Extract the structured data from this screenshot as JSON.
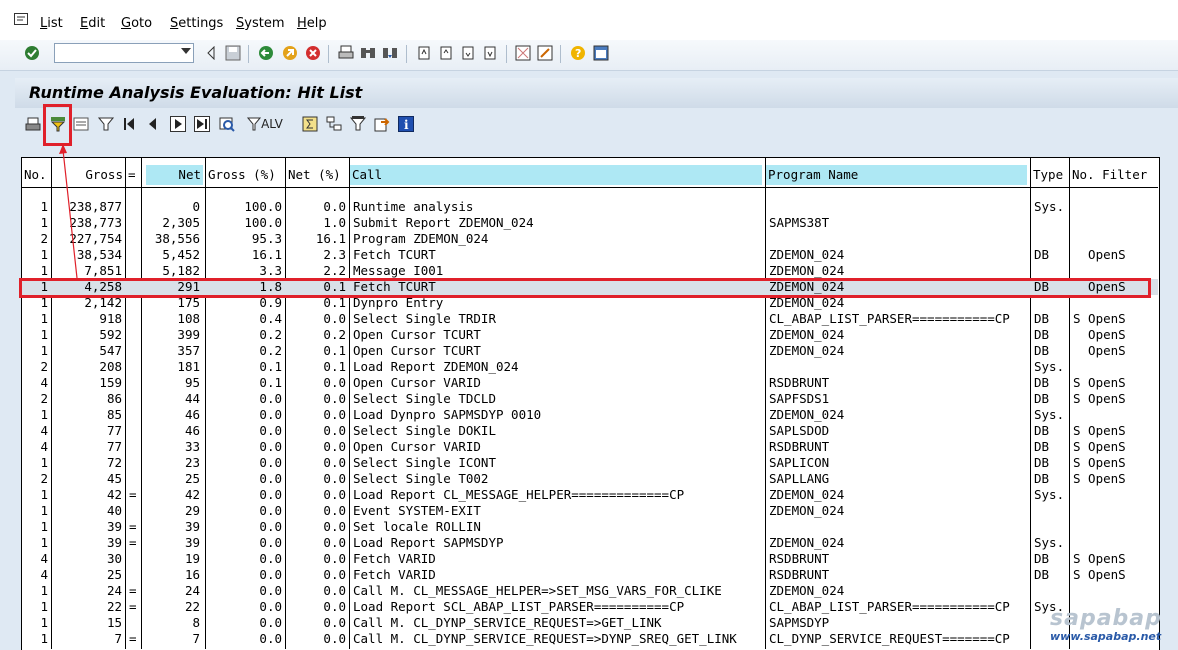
{
  "menu": {
    "items": [
      {
        "label": "List",
        "u": "L",
        "rest": "ist"
      },
      {
        "label": "Edit",
        "u": "E",
        "rest": "dit"
      },
      {
        "label": "Goto",
        "u": "G",
        "rest": "oto"
      },
      {
        "label": "Settings",
        "u": "S",
        "rest": "ettings"
      },
      {
        "label": "System",
        "u": "S",
        "rest": "ystem"
      },
      {
        "label": "Help",
        "u": "H",
        "rest": "elp"
      }
    ]
  },
  "command_field": {
    "value": ""
  },
  "title": "Runtime Analysis Evaluation: Hit List",
  "app_toolbar": {
    "alv_label": "ALV"
  },
  "colors": {
    "highlight_header": "#aee8f4",
    "annotation_red": "#e0202a",
    "background": "#dfe9f3"
  },
  "table": {
    "headers": {
      "no": "No.",
      "gross": "Gross",
      "eq": "=",
      "net": "Net",
      "gross_pct": "Gross (%)",
      "net_pct": "Net (%)",
      "call": "Call",
      "program": "Program Name",
      "type": "Type",
      "filter": "No. Filter"
    },
    "rows": [
      {
        "no": "1",
        "gross": "238,877",
        "eq": "",
        "net": "0",
        "gross_pct": "100.0",
        "net_pct": "0.0",
        "call": "Runtime analysis",
        "program": "",
        "type": "Sys.",
        "filter": ""
      },
      {
        "no": "1",
        "gross": "238,773",
        "eq": "",
        "net": "2,305",
        "gross_pct": "100.0",
        "net_pct": "1.0",
        "call": "Submit Report ZDEMON_024",
        "program": "SAPMS38T",
        "type": "",
        "filter": ""
      },
      {
        "no": "2",
        "gross": "227,754",
        "eq": "",
        "net": "38,556",
        "gross_pct": "95.3",
        "net_pct": "16.1",
        "call": "Program ZDEMON_024",
        "program": "",
        "type": "",
        "filter": ""
      },
      {
        "no": "1",
        "gross": "38,534",
        "eq": "",
        "net": "5,452",
        "gross_pct": "16.1",
        "net_pct": "2.3",
        "call": "Fetch TCURT",
        "program": "ZDEMON_024",
        "type": "DB",
        "filter": "  OpenS"
      },
      {
        "no": "1",
        "gross": "7,851",
        "eq": "",
        "net": "5,182",
        "gross_pct": "3.3",
        "net_pct": "2.2",
        "call": "Message I001",
        "program": "ZDEMON_024",
        "type": "",
        "filter": ""
      },
      {
        "no": "1",
        "gross": "4,258",
        "eq": "",
        "net": "291",
        "gross_pct": "1.8",
        "net_pct": "0.1",
        "call": "Fetch TCURT",
        "program": "ZDEMON_024",
        "type": "DB",
        "filter": "  OpenS",
        "selected": true
      },
      {
        "no": "1",
        "gross": "2,142",
        "eq": "",
        "net": "175",
        "gross_pct": "0.9",
        "net_pct": "0.1",
        "call": "Dynpro Entry",
        "program": "ZDEMON_024",
        "type": "",
        "filter": ""
      },
      {
        "no": "1",
        "gross": "918",
        "eq": "",
        "net": "108",
        "gross_pct": "0.4",
        "net_pct": "0.0",
        "call": "Select Single TRDIR",
        "program": "CL_ABAP_LIST_PARSER===========CP",
        "type": "DB",
        "filter": "S OpenS"
      },
      {
        "no": "1",
        "gross": "592",
        "eq": "",
        "net": "399",
        "gross_pct": "0.2",
        "net_pct": "0.2",
        "call": "Open Cursor TCURT",
        "program": "ZDEMON_024",
        "type": "DB",
        "filter": "  OpenS"
      },
      {
        "no": "1",
        "gross": "547",
        "eq": "",
        "net": "357",
        "gross_pct": "0.2",
        "net_pct": "0.1",
        "call": "Open Cursor TCURT",
        "program": "ZDEMON_024",
        "type": "DB",
        "filter": "  OpenS"
      },
      {
        "no": "2",
        "gross": "208",
        "eq": "",
        "net": "181",
        "gross_pct": "0.1",
        "net_pct": "0.1",
        "call": "Load Report ZDEMON_024",
        "program": "",
        "type": "Sys.",
        "filter": ""
      },
      {
        "no": "4",
        "gross": "159",
        "eq": "",
        "net": "95",
        "gross_pct": "0.1",
        "net_pct": "0.0",
        "call": "Open Cursor VARID",
        "program": "RSDBRUNT",
        "type": "DB",
        "filter": "S OpenS"
      },
      {
        "no": "2",
        "gross": "86",
        "eq": "",
        "net": "44",
        "gross_pct": "0.0",
        "net_pct": "0.0",
        "call": "Select Single TDCLD",
        "program": "SAPFSDS1",
        "type": "DB",
        "filter": "S OpenS"
      },
      {
        "no": "1",
        "gross": "85",
        "eq": "",
        "net": "46",
        "gross_pct": "0.0",
        "net_pct": "0.0",
        "call": "Load Dynpro SAPMSDYP 0010",
        "program": "ZDEMON_024",
        "type": "Sys.",
        "filter": ""
      },
      {
        "no": "4",
        "gross": "77",
        "eq": "",
        "net": "46",
        "gross_pct": "0.0",
        "net_pct": "0.0",
        "call": "Select Single DOKIL",
        "program": "SAPLSDOD",
        "type": "DB",
        "filter": "S OpenS"
      },
      {
        "no": "4",
        "gross": "77",
        "eq": "",
        "net": "33",
        "gross_pct": "0.0",
        "net_pct": "0.0",
        "call": "Open Cursor VARID",
        "program": "RSDBRUNT",
        "type": "DB",
        "filter": "S OpenS"
      },
      {
        "no": "1",
        "gross": "72",
        "eq": "",
        "net": "23",
        "gross_pct": "0.0",
        "net_pct": "0.0",
        "call": "Select Single ICONT",
        "program": "SAPLICON",
        "type": "DB",
        "filter": "S OpenS"
      },
      {
        "no": "2",
        "gross": "45",
        "eq": "",
        "net": "25",
        "gross_pct": "0.0",
        "net_pct": "0.0",
        "call": "Select Single T002",
        "program": "SAPLLANG",
        "type": "DB",
        "filter": "S OpenS"
      },
      {
        "no": "1",
        "gross": "42",
        "eq": "=",
        "net": "42",
        "gross_pct": "0.0",
        "net_pct": "0.0",
        "call": "Load Report CL_MESSAGE_HELPER=============CP",
        "program": "ZDEMON_024",
        "type": "Sys.",
        "filter": ""
      },
      {
        "no": "1",
        "gross": "40",
        "eq": "",
        "net": "29",
        "gross_pct": "0.0",
        "net_pct": "0.0",
        "call": "Event SYSTEM-EXIT",
        "program": "ZDEMON_024",
        "type": "",
        "filter": ""
      },
      {
        "no": "1",
        "gross": "39",
        "eq": "=",
        "net": "39",
        "gross_pct": "0.0",
        "net_pct": "0.0",
        "call": "Set locale ROLLIN",
        "program": "",
        "type": "",
        "filter": ""
      },
      {
        "no": "1",
        "gross": "39",
        "eq": "=",
        "net": "39",
        "gross_pct": "0.0",
        "net_pct": "0.0",
        "call": "Load Report SAPMSDYP",
        "program": "ZDEMON_024",
        "type": "Sys.",
        "filter": ""
      },
      {
        "no": "4",
        "gross": "30",
        "eq": "",
        "net": "19",
        "gross_pct": "0.0",
        "net_pct": "0.0",
        "call": "Fetch VARID",
        "program": "RSDBRUNT",
        "type": "DB",
        "filter": "S OpenS"
      },
      {
        "no": "4",
        "gross": "25",
        "eq": "",
        "net": "16",
        "gross_pct": "0.0",
        "net_pct": "0.0",
        "call": "Fetch VARID",
        "program": "RSDBRUNT",
        "type": "DB",
        "filter": "S OpenS"
      },
      {
        "no": "1",
        "gross": "24",
        "eq": "=",
        "net": "24",
        "gross_pct": "0.0",
        "net_pct": "0.0",
        "call": "Call M. CL_MESSAGE_HELPER=>SET_MSG_VARS_FOR_CLIKE",
        "program": "ZDEMON_024",
        "type": "",
        "filter": ""
      },
      {
        "no": "1",
        "gross": "22",
        "eq": "=",
        "net": "22",
        "gross_pct": "0.0",
        "net_pct": "0.0",
        "call": "Load Report SCL_ABAP_LIST_PARSER==========CP",
        "program": "CL_ABAP_LIST_PARSER===========CP",
        "type": "Sys.",
        "filter": ""
      },
      {
        "no": "1",
        "gross": "15",
        "eq": "",
        "net": "8",
        "gross_pct": "0.0",
        "net_pct": "0.0",
        "call": "Call M. CL_DYNP_SERVICE_REQUEST=>GET_LINK",
        "program": "SAPMSDYP",
        "type": "",
        "filter": ""
      },
      {
        "no": "1",
        "gross": "7",
        "eq": "=",
        "net": "7",
        "gross_pct": "0.0",
        "net_pct": "0.0",
        "call": "Call M. CL_DYNP_SERVICE_REQUEST=>DYNP_SREQ_GET_LINK",
        "program": "CL_DYNP_SERVICE_REQUEST=======CP",
        "type": "",
        "filter": ""
      }
    ]
  },
  "watermark": {
    "brand": "sapabap",
    "url": "www.sapabap.net"
  }
}
